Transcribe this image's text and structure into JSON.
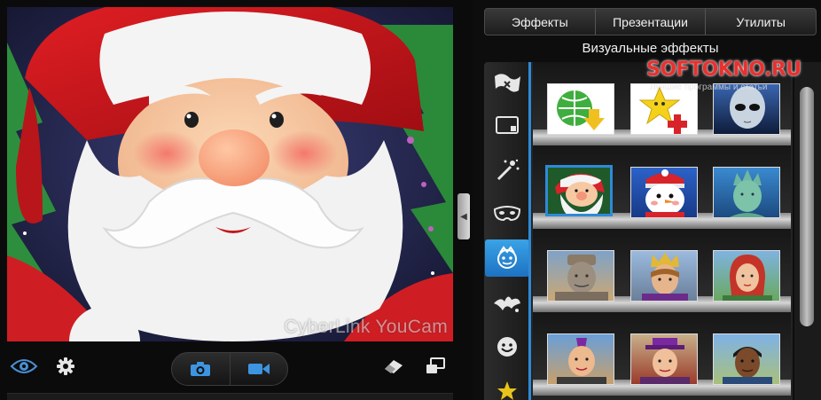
{
  "preview": {
    "watermark": "CyberLink YouCam"
  },
  "toolbar": {
    "eye_icon": "eye-icon",
    "settings_icon": "gear-icon",
    "photo_icon": "camera-icon",
    "video_icon": "video-camera-icon",
    "eraser_icon": "eraser-icon",
    "swap_icon": "window-swap-icon"
  },
  "tabs": [
    {
      "label": "Эффекты"
    },
    {
      "label": "Презентации"
    },
    {
      "label": "Утилиты"
    }
  ],
  "section": {
    "title": "Визуальные эффекты"
  },
  "watermark_logo": {
    "text": "SOFTOKNO.RU",
    "subtitle": "Лучшие программы и статьи"
  },
  "sidebar": {
    "items": [
      {
        "icon": "flag-icon"
      },
      {
        "icon": "frame-icon"
      },
      {
        "icon": "magic-wand-icon"
      },
      {
        "icon": "mask-icon"
      },
      {
        "icon": "avatar-face-icon",
        "active": true
      },
      {
        "icon": "splash-icon"
      },
      {
        "icon": "smiley-icon"
      },
      {
        "icon": "star-icon"
      }
    ]
  },
  "effects": {
    "rows": [
      [
        "globe-download",
        "star-plus",
        "alien"
      ],
      [
        "santa",
        "snowman",
        "statue-of-liberty"
      ],
      [
        "terracotta-warrior",
        "king",
        "red-hair-woman"
      ],
      [
        "man-mohawk",
        "man-purple-hat",
        "man-dark"
      ]
    ],
    "selected": "santa"
  },
  "colors": {
    "accent": "#2e8ad8",
    "logo_red": "#e8312f"
  }
}
